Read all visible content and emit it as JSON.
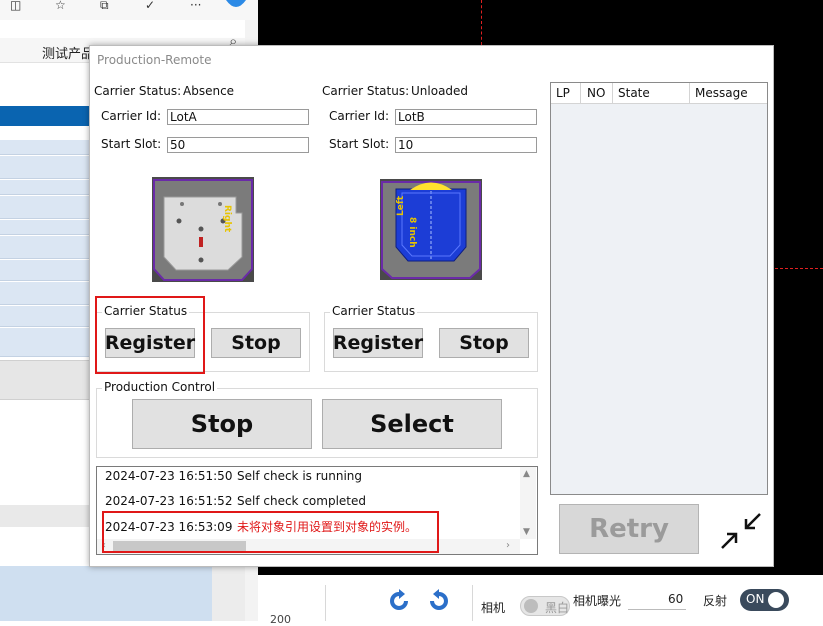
{
  "background_window": {
    "header_text": "测试产品"
  },
  "bottom_bar": {
    "number": "200",
    "camera_label": "相机",
    "bw_toggle_text": "黑白",
    "exposure_label": "相机曝光",
    "exposure_value": "60",
    "reflect_label": "反射",
    "reflect_toggle_text": "ON"
  },
  "dialog": {
    "title": "Production-Remote",
    "port1": {
      "carrier_status_label": "Carrier Status:",
      "carrier_status_value": "Absence",
      "carrier_id_label": "Carrier Id:",
      "carrier_id_value": "LotA",
      "start_slot_label": "Start Slot:",
      "start_slot_value": "50",
      "image_text": "Right",
      "group_title": "Carrier Status",
      "register_label": "Register",
      "stop_label": "Stop"
    },
    "port2": {
      "carrier_status_label": "Carrier Status:",
      "carrier_status_value": "Unloaded",
      "carrier_id_label": "Carrier Id:",
      "carrier_id_value": "LotB",
      "start_slot_label": "Start Slot:",
      "start_slot_value": "10",
      "image_text_size": "8 inch",
      "image_text_side": "Left",
      "group_title": "Carrier Status",
      "register_label": "Register",
      "stop_label": "Stop"
    },
    "production_control": {
      "title": "Production Control",
      "stop_label": "Stop",
      "select_label": "Select"
    },
    "log": [
      {
        "time": "2024-07-23 16:51:50",
        "message": "Self check is running",
        "color": "#111111"
      },
      {
        "time": "2024-07-23 16:51:52",
        "message": "Self check completed",
        "color": "#111111"
      },
      {
        "time": "2024-07-23 16:53:09",
        "message": "未将对象引用设置到对象的实例。",
        "color": "#e01818"
      }
    ],
    "lp_table": {
      "columns": [
        "LP",
        "NO",
        "State",
        "Message"
      ]
    },
    "retry_label": "Retry"
  },
  "colors": {
    "highlight_red": "#e01818",
    "selection_blue": "#0a64b0",
    "wafer_blue": "#1c3dd6",
    "wafer_yellow": "#ffe22e"
  }
}
